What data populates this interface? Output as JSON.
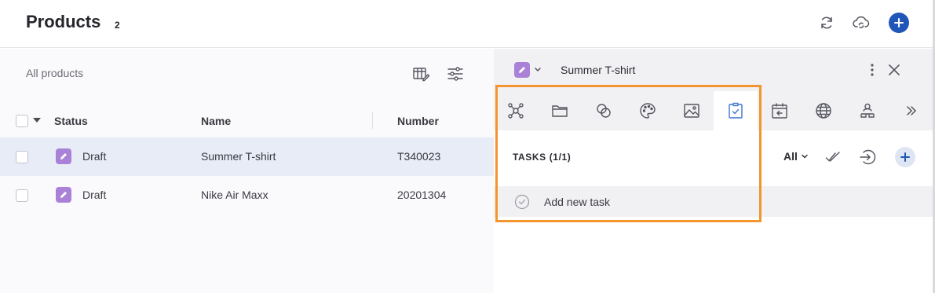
{
  "header": {
    "title": "Products",
    "count": "2",
    "icons": {
      "sync": "sync-icon",
      "cloud": "cloud-sync-icon",
      "add": "plus-icon"
    },
    "accent": "#1f57b8"
  },
  "list": {
    "view_name": "All products",
    "columns": {
      "status": "Status",
      "name": "Name",
      "number": "Number"
    },
    "rows": [
      {
        "status": "Draft",
        "name": "Summer T-shirt",
        "number": "T340023",
        "selected": true
      },
      {
        "status": "Draft",
        "name": "Nike Air Maxx",
        "number": "20201304",
        "selected": false
      }
    ]
  },
  "detail": {
    "title": "Summer T-shirt",
    "tabs": [
      "hub-icon",
      "folder-icon",
      "links-icon",
      "palette-icon",
      "image-icon",
      "tasks-icon",
      "calendar-icon",
      "globe-icon",
      "team-icon",
      "more-tabs-icon"
    ],
    "active_tab": "tasks-icon",
    "tasks": {
      "heading": "TASKS (1/1)",
      "filter": "All",
      "new_task_placeholder": "Add new task"
    }
  },
  "colors": {
    "draft": "#a982d8",
    "highlight": "#f2952f",
    "selected_row": "#e7ecf6"
  }
}
